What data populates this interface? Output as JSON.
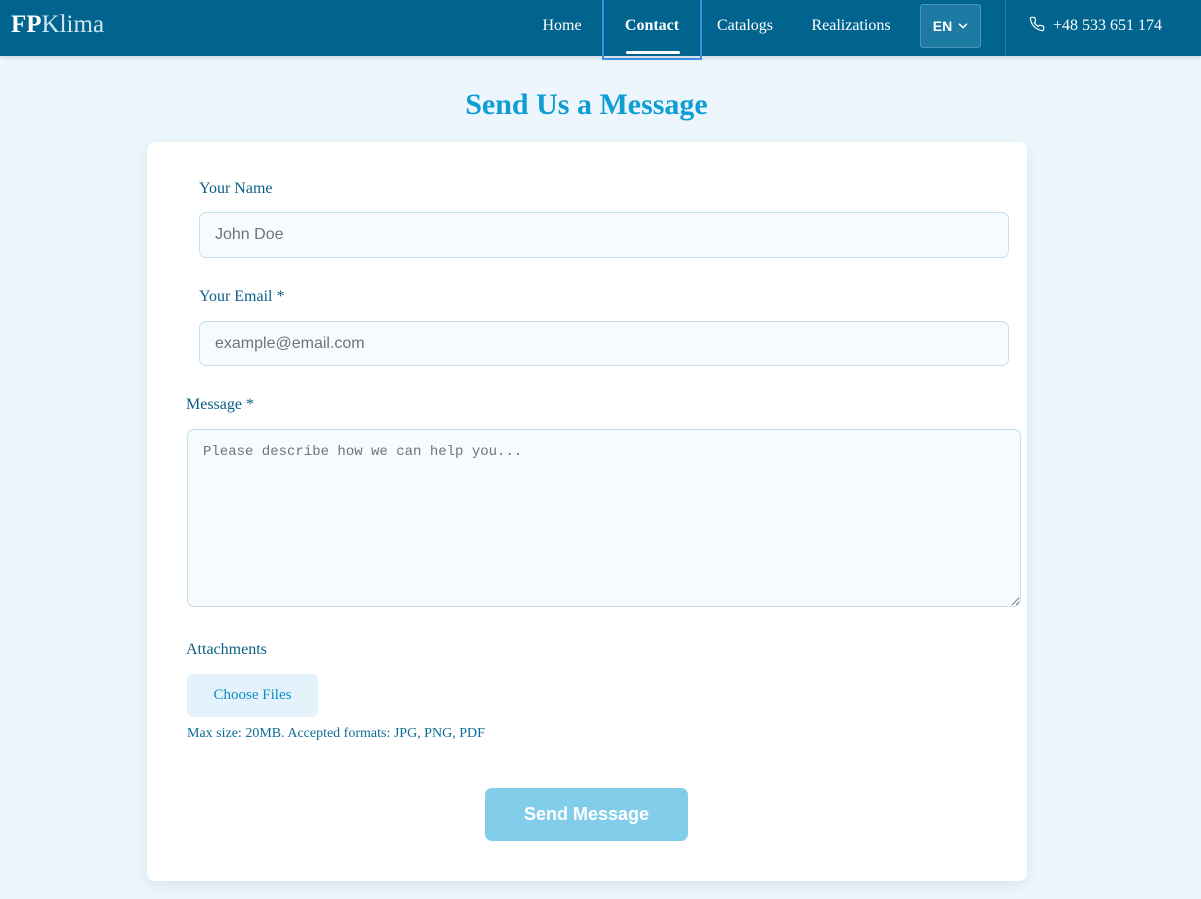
{
  "header": {
    "logo_bold": "FP",
    "logo_rest": "Klima",
    "nav": {
      "home": "Home",
      "contact": "Contact",
      "catalogs": "Catalogs",
      "realizations": "Realizations"
    },
    "language": "EN",
    "phone": "+48 533 651 174"
  },
  "form": {
    "title": "Send Us a Message",
    "name_label": "Your Name",
    "name_placeholder": "John Doe",
    "email_label": "Your Email *",
    "email_placeholder": "example@email.com",
    "message_label": "Message *",
    "message_placeholder": "Please describe how we can help you...",
    "attachments_label": "Attachments",
    "choose_files": "Choose Files",
    "attachments_hint": "Max size: 20MB. Accepted formats: JPG, PNG, PDF",
    "submit": "Send Message"
  },
  "colors": {
    "header_bg": "#01648f",
    "title": "#0e9dd4",
    "submit_bg": "#82cdea"
  }
}
